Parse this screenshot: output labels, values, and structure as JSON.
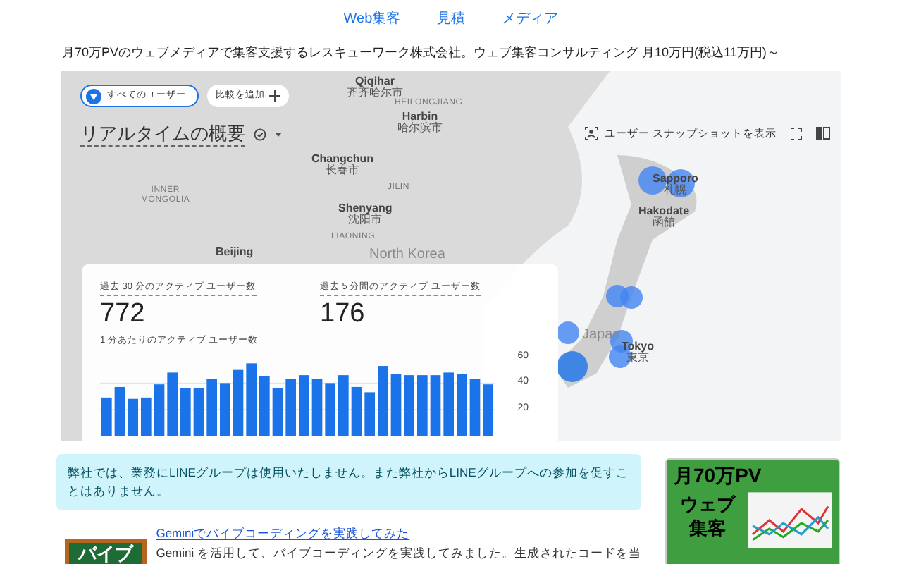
{
  "nav": [
    {
      "label": "Web集客"
    },
    {
      "label": "見積"
    },
    {
      "label": "メディア"
    }
  ],
  "tagline": "月70万PVのウェブメディアで集客支援するレスキューワーク株式会社。ウェブ集客コンサルティング 月10万円(税込11万円)～",
  "analytics": {
    "chips": [
      {
        "label": "すべてのユーザー",
        "kind": "segment"
      },
      {
        "label": "比較を追加",
        "kind": "add"
      }
    ],
    "title": "リアルタイムの概要",
    "snapshot_button": "ユーザー スナップショットを表示",
    "map_labels": [
      {
        "name": "Qiqihar",
        "local": "齐齐哈尔市",
        "kind": "city"
      },
      {
        "name": "HEILONGJIANG",
        "kind": "region"
      },
      {
        "name": "Harbin",
        "local": "哈尔滨市",
        "kind": "city"
      },
      {
        "name": "Changchun",
        "local": "长春市",
        "kind": "city"
      },
      {
        "name": "JILIN",
        "kind": "region"
      },
      {
        "name": "INNER MONGOLIA",
        "kind": "region"
      },
      {
        "name": "Shenyang",
        "local": "沈阳市",
        "kind": "city"
      },
      {
        "name": "LIAONING",
        "kind": "region"
      },
      {
        "name": "Beijing",
        "kind": "city"
      },
      {
        "name": "North Korea",
        "kind": "country"
      },
      {
        "name": "Sapporo",
        "local": "札幌",
        "kind": "city"
      },
      {
        "name": "Hakodate",
        "local": "函館",
        "kind": "city"
      },
      {
        "name": "Japan",
        "kind": "country"
      },
      {
        "name": "Tokyo",
        "local": "東京",
        "kind": "city"
      }
    ],
    "metrics": [
      {
        "label": "過去 30 分のアクティブ ユーザー数",
        "value": "772"
      },
      {
        "label": "過去 5 分間のアクティブ ユーザー数",
        "value": "176"
      }
    ],
    "chart_title": "1 分あたりのアクティブ ユーザー数",
    "chart_data": {
      "type": "bar",
      "ylim": [
        0,
        60
      ],
      "yticks": [
        20,
        40,
        60
      ],
      "grid": true,
      "values": [
        29,
        37,
        28,
        29,
        39,
        48,
        36,
        36,
        43,
        40,
        50,
        55,
        45,
        36,
        43,
        46,
        43,
        40,
        46,
        37,
        33,
        53,
        47,
        46,
        46,
        46,
        48,
        47,
        43,
        39
      ]
    }
  },
  "notice": "弊社では、業務にLINEグループは使用いたしません。また弊社からLINEグループへの参加を促すことはありません。",
  "article": {
    "thumbnail_text": "バイブ",
    "title": "Geminiでバイブコーディングを実践してみた",
    "excerpt": "Gemini を活用して、バイブコーディングを実践してみました。生成されたコードを当"
  },
  "ad": {
    "headline": "月70万PV",
    "subline": [
      "ウェブ",
      "集客"
    ]
  }
}
